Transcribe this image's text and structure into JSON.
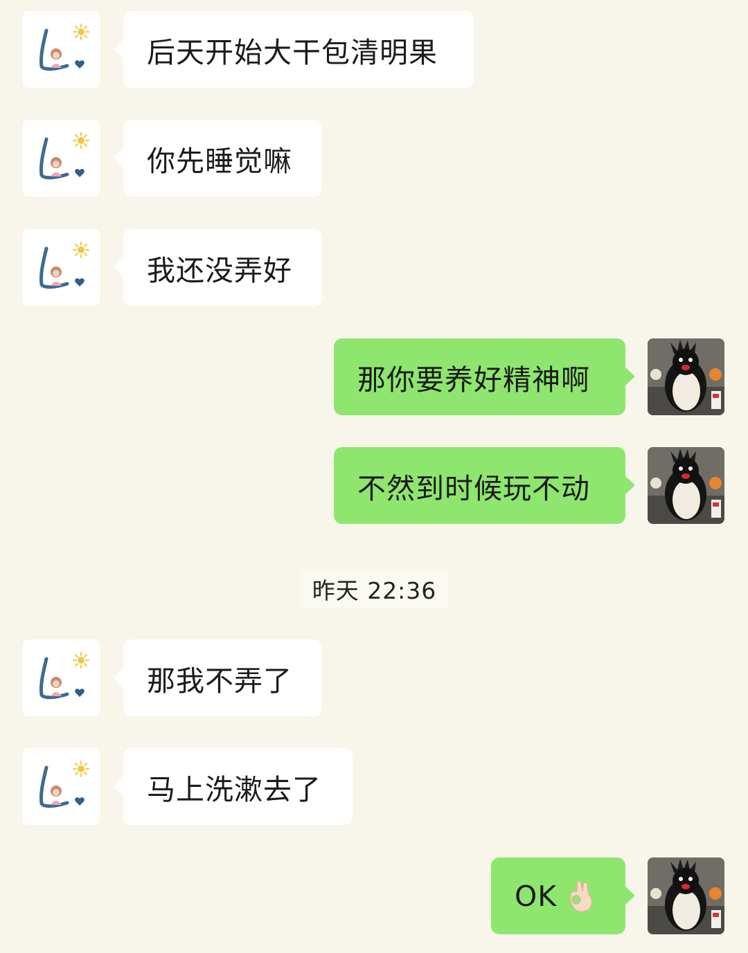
{
  "conversation": {
    "messages": [
      {
        "sender": "contact",
        "text": "后天开始大干包清明果",
        "avatar": "hand-drawn-girl-avatar"
      },
      {
        "sender": "contact",
        "text": "你先睡觉嘛",
        "avatar": "hand-drawn-girl-avatar"
      },
      {
        "sender": "contact",
        "text": "我还没弄好",
        "avatar": "hand-drawn-girl-avatar"
      },
      {
        "sender": "self",
        "text": "那你要养好精神啊",
        "avatar": "penguin-plush-avatar"
      },
      {
        "sender": "self",
        "text": "不然到时候玩不动",
        "avatar": "penguin-plush-avatar"
      },
      {
        "sender": "contact",
        "text": "那我不弄了",
        "avatar": "hand-drawn-girl-avatar"
      },
      {
        "sender": "contact",
        "text": "马上洗漱去了",
        "avatar": "hand-drawn-girl-avatar"
      },
      {
        "sender": "self",
        "text": "OK",
        "emoji": "ok-hand-emoji",
        "avatar": "penguin-plush-avatar"
      }
    ],
    "timestamp": "昨天 22:36"
  },
  "colors": {
    "background": "#f8f6ea",
    "incoming_bubble": "#ffffff",
    "outgoing_bubble": "#8fe66f",
    "text": "#1b1b1b"
  }
}
